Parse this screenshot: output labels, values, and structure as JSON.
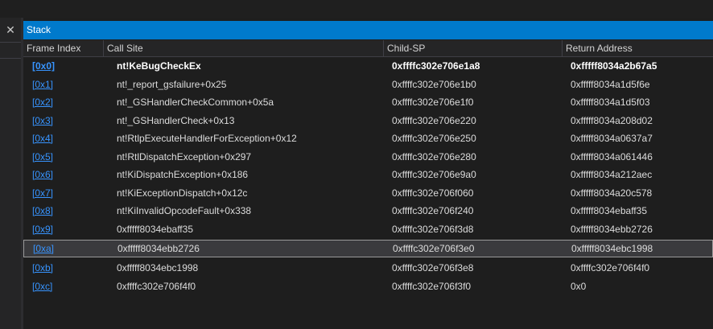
{
  "panel": {
    "title": "Stack",
    "close_glyph": "✕"
  },
  "columns": {
    "frame_index": "Frame Index",
    "call_site": "Call Site",
    "child_sp": "Child-SP",
    "return_address": "Return Address"
  },
  "rows": [
    {
      "idx": "[0x0]",
      "site": "nt!KeBugCheckEx",
      "sp": "0xffffc302e706e1a8",
      "ret": "0xfffff8034a2b67a5"
    },
    {
      "idx": "[0x1]",
      "site": "nt!_report_gsfailure+0x25",
      "sp": "0xffffc302e706e1b0",
      "ret": "0xfffff8034a1d5f6e"
    },
    {
      "idx": "[0x2]",
      "site": "nt!_GSHandlerCheckCommon+0x5a",
      "sp": "0xffffc302e706e1f0",
      "ret": "0xfffff8034a1d5f03"
    },
    {
      "idx": "[0x3]",
      "site": "nt!_GSHandlerCheck+0x13",
      "sp": "0xffffc302e706e220",
      "ret": "0xfffff8034a208d02"
    },
    {
      "idx": "[0x4]",
      "site": "nt!RtlpExecuteHandlerForException+0x12",
      "sp": "0xffffc302e706e250",
      "ret": "0xfffff8034a0637a7"
    },
    {
      "idx": "[0x5]",
      "site": "nt!RtlDispatchException+0x297",
      "sp": "0xffffc302e706e280",
      "ret": "0xfffff8034a061446"
    },
    {
      "idx": "[0x6]",
      "site": "nt!KiDispatchException+0x186",
      "sp": "0xffffc302e706e9a0",
      "ret": "0xfffff8034a212aec"
    },
    {
      "idx": "[0x7]",
      "site": "nt!KiExceptionDispatch+0x12c",
      "sp": "0xffffc302e706f060",
      "ret": "0xfffff8034a20c578"
    },
    {
      "idx": "[0x8]",
      "site": "nt!KiInvalidOpcodeFault+0x338",
      "sp": "0xffffc302e706f240",
      "ret": "0xfffff8034ebaff35"
    },
    {
      "idx": "[0x9]",
      "site": "0xfffff8034ebaff35",
      "sp": "0xffffc302e706f3d8",
      "ret": "0xfffff8034ebb2726"
    },
    {
      "idx": "[0xa]",
      "site": "0xfffff8034ebb2726",
      "sp": "0xffffc302e706f3e0",
      "ret": "0xfffff8034ebc1998"
    },
    {
      "idx": "[0xb]",
      "site": "0xfffff8034ebc1998",
      "sp": "0xffffc302e706f3e8",
      "ret": "0xffffc302e706f4f0"
    },
    {
      "idx": "[0xc]",
      "site": "0xffffc302e706f4f0",
      "sp": "0xffffc302e706f3f0",
      "ret": "0x0"
    }
  ]
}
